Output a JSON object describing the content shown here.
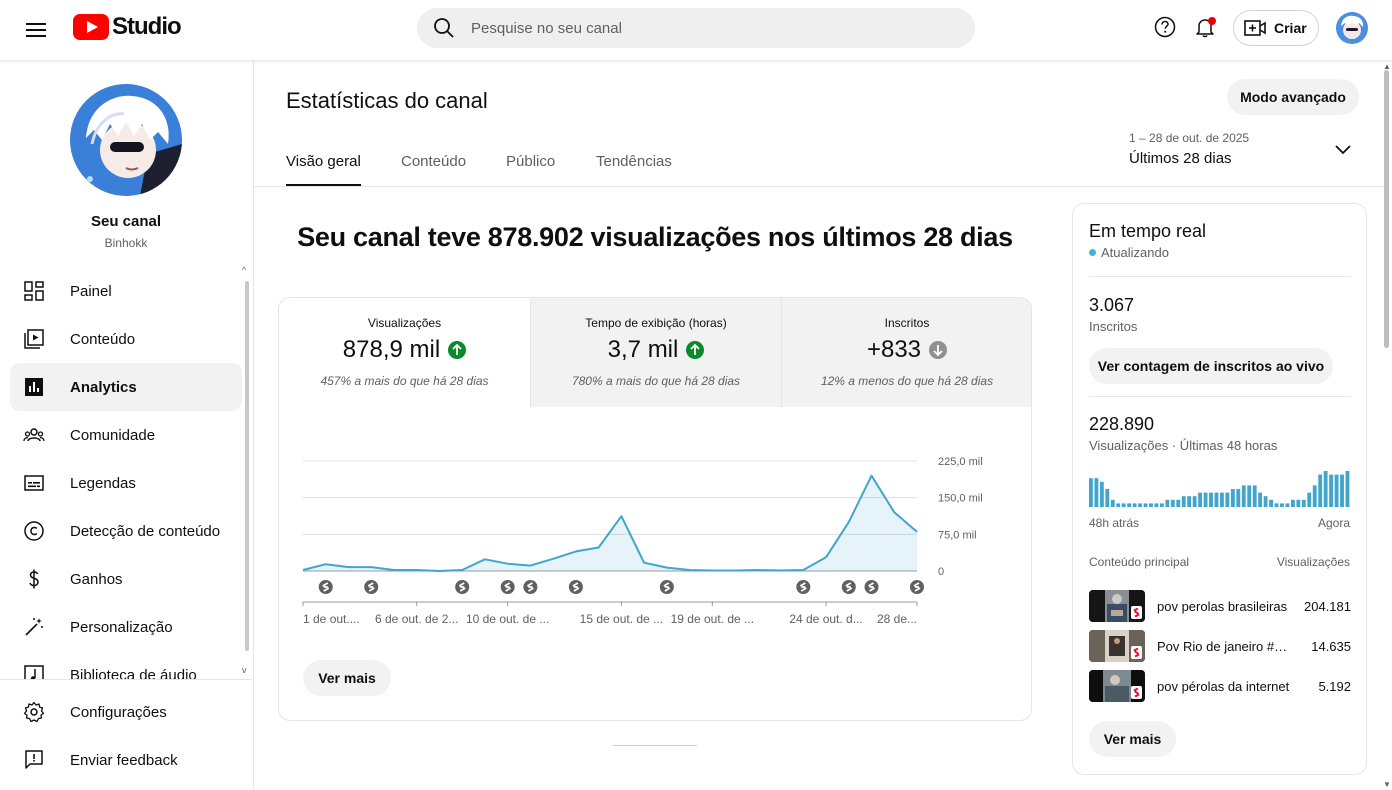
{
  "header": {
    "logo_text": "Studio",
    "search_placeholder": "Pesquise no seu canal",
    "create_label": "Criar"
  },
  "sidebar": {
    "channel_name": "Seu canal",
    "channel_handle": "Binhokk",
    "items": [
      {
        "label": "Painel",
        "icon": "dashboard-icon"
      },
      {
        "label": "Conteúdo",
        "icon": "content-icon"
      },
      {
        "label": "Analytics",
        "icon": "analytics-icon",
        "active": true
      },
      {
        "label": "Comunidade",
        "icon": "community-icon"
      },
      {
        "label": "Legendas",
        "icon": "subtitles-icon"
      },
      {
        "label": "Detecção de conteúdo",
        "icon": "copyright-icon"
      },
      {
        "label": "Ganhos",
        "icon": "earn-icon"
      },
      {
        "label": "Personalização",
        "icon": "customization-icon"
      },
      {
        "label": "Biblioteca de áudio",
        "icon": "audio-library-icon"
      }
    ],
    "bottom_items": [
      {
        "label": "Configurações",
        "icon": "settings-icon"
      },
      {
        "label": "Enviar feedback",
        "icon": "feedback-icon"
      }
    ]
  },
  "main": {
    "title": "Estatísticas do canal",
    "advanced_mode": "Modo avançado",
    "tabs": [
      "Visão geral",
      "Conteúdo",
      "Público",
      "Tendências"
    ],
    "date_range": "1 – 28 de out. de 2025",
    "date_label": "Últimos 28 dias",
    "headline": "Seu canal teve 878.902 visualizações nos últimos 28 dias",
    "metrics": [
      {
        "label": "Visualizações",
        "value": "878,9 mil",
        "trend": "up",
        "change": "457% a mais do que há 28 dias"
      },
      {
        "label": "Tempo de exibição (horas)",
        "value": "3,7 mil",
        "trend": "up",
        "change": "780% a mais do que há 28 dias"
      },
      {
        "label": "Inscritos",
        "value": "+833",
        "trend": "down",
        "change": "12% a menos do que há 28 dias"
      }
    ],
    "see_more": "Ver mais"
  },
  "colors": {
    "accent_line": "#41a5cc",
    "up_green": "#0a8a2a",
    "down_gray": "#909090",
    "brand_red": "#ff0000"
  },
  "chart_data": {
    "type": "area",
    "x": [
      "1 de out.",
      "2 de out.",
      "3 de out.",
      "4 de out.",
      "5 de out.",
      "6 de out.",
      "7 de out.",
      "8 de out.",
      "9 de out.",
      "10 de out.",
      "11 de out.",
      "12 de out.",
      "13 de out.",
      "14 de out.",
      "15 de out.",
      "16 de out.",
      "17 de out.",
      "18 de out.",
      "19 de out.",
      "20 de out.",
      "21 de out.",
      "22 de out.",
      "23 de out.",
      "24 de out.",
      "25 de out.",
      "26 de out.",
      "27 de out.",
      "28 de out."
    ],
    "values": [
      2000,
      14000,
      8000,
      8000,
      2000,
      2000,
      0,
      2000,
      24000,
      15000,
      11000,
      25000,
      40000,
      48000,
      112000,
      17000,
      7000,
      2000,
      1000,
      1000,
      2000,
      1000,
      2000,
      28000,
      100000,
      195000,
      120000,
      80000
    ],
    "uploads_on": [
      "2 de out.",
      "4 de out.",
      "8 de out.",
      "10 de out.",
      "11 de out.",
      "13 de out.",
      "17 de out.",
      "23 de out.",
      "25 de out.",
      "26 de out.",
      "28 de out."
    ],
    "x_tick_labels": [
      "1 de out....",
      "6 de out. de 2...",
      "10 de out. de ...",
      "15 de out. de ...",
      "19 de out. de ...",
      "24 de out. d...",
      "28 de..."
    ],
    "x_tick_index": [
      0,
      5,
      9,
      14,
      18,
      23,
      27
    ],
    "y_tick_labels": [
      "225,0 mil",
      "150,0 mil",
      "75,0 mil",
      "0"
    ],
    "y_tick_values": [
      225000,
      150000,
      75000,
      0
    ],
    "ylim": [
      0,
      225000
    ],
    "grid": true,
    "legend": "none"
  },
  "realtime": {
    "title": "Em tempo real",
    "status": "Atualizando",
    "subscribers_value": "3.067",
    "subscribers_label": "Inscritos",
    "live_button": "Ver contagem de inscritos ao vivo",
    "views_value": "228.890",
    "views_label": "Visualizações · Últimas 48 horas",
    "axis_start": "48h atrás",
    "axis_end": "Agora",
    "hourly_views": [
      8,
      8,
      7,
      5,
      2,
      1,
      1,
      1,
      1,
      1,
      1,
      1,
      1,
      1,
      2,
      2,
      2,
      3,
      3,
      3,
      4,
      4,
      4,
      4,
      4,
      4,
      5,
      5,
      6,
      6,
      6,
      4,
      3,
      2,
      1,
      1,
      1,
      2,
      2,
      2,
      4,
      6,
      9,
      10,
      9,
      9,
      9,
      10
    ],
    "top_content_header": "Conteúdo principal",
    "top_views_header": "Visualizações",
    "top_content": [
      {
        "title": "pov perolas brasileiras",
        "views": "204.181"
      },
      {
        "title": "Pov Rio de janeiro #shorts",
        "views": "14.635"
      },
      {
        "title": "pov pérolas da internet",
        "views": "5.192"
      }
    ],
    "see_more": "Ver mais"
  }
}
